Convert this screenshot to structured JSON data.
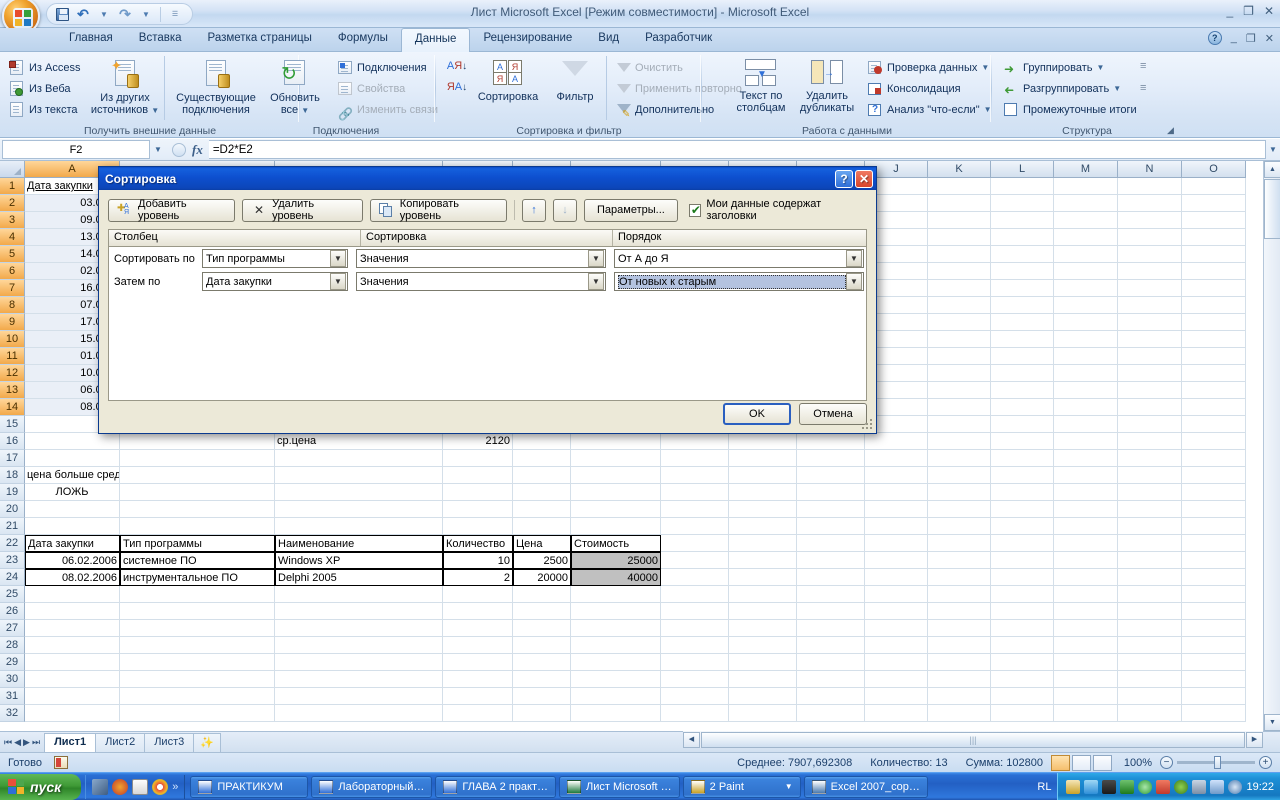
{
  "window": {
    "title": "Лист Microsoft Excel  [Режим совместимости] - Microsoft Excel",
    "minimize": "_",
    "maximize": "❐",
    "close": "✕"
  },
  "quick_access": {
    "save": "save-icon",
    "undo": "↶",
    "redo": "↷",
    "customize": "☰"
  },
  "ribbon": {
    "tabs": [
      {
        "label": "Главная",
        "active": false
      },
      {
        "label": "Вставка",
        "active": false
      },
      {
        "label": "Разметка страницы",
        "active": false
      },
      {
        "label": "Формулы",
        "active": false
      },
      {
        "label": "Данные",
        "active": true
      },
      {
        "label": "Рецензирование",
        "active": false
      },
      {
        "label": "Вид",
        "active": false
      },
      {
        "label": "Разработчик",
        "active": false
      }
    ],
    "groups": [
      {
        "name": "Получить внешние данные",
        "small": [
          "Из Access",
          "Из Веба",
          "Из текста"
        ],
        "big": [
          {
            "line1": "Из других",
            "line2": "источников",
            "dropdown": true
          },
          {
            "line1": "Существующие",
            "line2": "подключения",
            "dropdown": false
          }
        ]
      },
      {
        "name": "Подключения",
        "big": [
          {
            "line1": "Обновить",
            "line2": "все",
            "dropdown": true
          }
        ],
        "small": [
          "Подключения",
          "Свойства",
          "Изменить связи"
        ],
        "disabled": [
          "Свойства",
          "Изменить связи"
        ]
      },
      {
        "name": "Сортировка и фильтр",
        "big": [
          {
            "line1": "Сортировка",
            "line2": "",
            "dropdown": false
          },
          {
            "line1": "Фильтр",
            "line2": "",
            "dropdown": false
          }
        ],
        "small": [
          "Очистить",
          "Применить повторно",
          "Дополнительно"
        ],
        "disabled": [
          "Очистить",
          "Применить повторно"
        ]
      },
      {
        "name": "Работа с данными",
        "big": [
          {
            "line1": "Текст по",
            "line2": "столбцам",
            "dropdown": false
          },
          {
            "line1": "Удалить",
            "line2": "дубликаты",
            "dropdown": false
          }
        ],
        "small": [
          "Проверка данных",
          "Консолидация",
          "Анализ \"что-если\""
        ]
      },
      {
        "name": "Структура",
        "small": [
          "Группировать",
          "Разгруппировать",
          "Промежуточные итоги"
        ]
      }
    ]
  },
  "formula_bar": {
    "name_box": "F2",
    "formula": "=D2*E2",
    "fx_label": "fx"
  },
  "grid": {
    "columns": [
      "A",
      "J",
      "K",
      "L",
      "M",
      "N",
      "O"
    ],
    "visible_col_headers_right": [
      "J",
      "K",
      "L",
      "M",
      "N",
      "O"
    ],
    "col_a_header": "A",
    "rows": [
      {
        "n": "1",
        "a": "Дата закупки"
      },
      {
        "n": "2",
        "a": "03.02.2"
      },
      {
        "n": "3",
        "a": "09.02.2"
      },
      {
        "n": "4",
        "a": "13.02.2"
      },
      {
        "n": "5",
        "a": "14.02.2"
      },
      {
        "n": "6",
        "a": "02.02.2"
      },
      {
        "n": "7",
        "a": "16.02.2"
      },
      {
        "n": "8",
        "a": "07.02.2"
      },
      {
        "n": "9",
        "a": "17.02.2"
      },
      {
        "n": "10",
        "a": "15.02.2"
      },
      {
        "n": "11",
        "a": "01.02.2"
      },
      {
        "n": "12",
        "a": "10.02.2"
      },
      {
        "n": "13",
        "a": "06.02.2"
      },
      {
        "n": "14",
        "a": "08.02.2"
      },
      {
        "n": "15",
        "a": ""
      },
      {
        "n": "16",
        "a": ""
      },
      {
        "n": "17",
        "a": ""
      },
      {
        "n": "18",
        "a": "цена больше средней"
      },
      {
        "n": "19",
        "a": "ЛОЖЬ"
      },
      {
        "n": "20",
        "a": ""
      },
      {
        "n": "21",
        "a": ""
      },
      {
        "n": "22",
        "a": "Дата закупки"
      },
      {
        "n": "23",
        "a": "06.02.2006"
      },
      {
        "n": "24",
        "a": "08.02.2006"
      },
      {
        "n": "25",
        "a": ""
      },
      {
        "n": "26",
        "a": ""
      },
      {
        "n": "27",
        "a": ""
      },
      {
        "n": "28",
        "a": ""
      },
      {
        "n": "29",
        "a": ""
      },
      {
        "n": "30",
        "a": ""
      },
      {
        "n": "31",
        "a": ""
      },
      {
        "n": "32",
        "a": ""
      }
    ],
    "avg_price_label": "ср.цена",
    "avg_price_value": "2120",
    "result_table": {
      "headers": [
        "Дата закупки",
        "Тип программы",
        "Наименование",
        "Количество",
        "Цена",
        "Стоимость"
      ],
      "rows": [
        [
          "06.02.2006",
          "системное ПО",
          "Windows XP",
          "10",
          "2500",
          "25000"
        ],
        [
          "08.02.2006",
          "инструментальное ПО",
          "Delphi 2005",
          "2",
          "20000",
          "40000"
        ]
      ]
    }
  },
  "sheet_tabs": {
    "nav": [
      "⏮",
      "◀",
      "▶",
      "⏭"
    ],
    "tabs": [
      "Лист1",
      "Лист2",
      "Лист3"
    ],
    "active": "Лист1",
    "new_sheet": "✨"
  },
  "status_bar": {
    "state": "Готово",
    "average": "Среднее: 7907,692308",
    "count": "Количество: 13",
    "sum": "Сумма: 102800",
    "zoom": "100%",
    "zoom_out": "−",
    "zoom_in": "+"
  },
  "dialog": {
    "title": "Сортировка",
    "help_btn": "?",
    "close_btn": "✕",
    "buttons": {
      "add_level": "Добавить уровень",
      "delete_level": "Удалить уровень",
      "copy_level": "Копировать уровень",
      "move_up": "↑",
      "move_down": "↓",
      "options": "Параметры...",
      "ok": "OK",
      "cancel": "Отмена"
    },
    "checkbox": {
      "label": "Мои данные содержат заголовки",
      "checked": true
    },
    "headers": {
      "column": "Столбец",
      "sort_on": "Сортировка",
      "order": "Порядок"
    },
    "levels": [
      {
        "label": "Сортировать по",
        "column": "Тип программы",
        "sort_on": "Значения",
        "order": "От А до Я",
        "order_selected": false
      },
      {
        "label": "Затем по",
        "column": "Дата закупки",
        "sort_on": "Значения",
        "order": "От новых к старым",
        "order_selected": true
      }
    ]
  },
  "taskbar": {
    "start": "пуск",
    "quick_launch_more": "»",
    "items": [
      {
        "label": "ПРАКТИКУМ",
        "icon": "word-icon"
      },
      {
        "label": "Лабораторный…",
        "icon": "word-icon"
      },
      {
        "label": "ГЛАВА 2 практ…",
        "icon": "word-icon"
      },
      {
        "label": "Лист Microsoft …",
        "icon": "excel-icon"
      },
      {
        "label": "2 Paint",
        "icon": "paint-icon",
        "dropdown": true
      },
      {
        "label": "Excel 2007_cop…",
        "icon": "help-icon"
      }
    ],
    "language": "RL",
    "clock": "19:22"
  }
}
